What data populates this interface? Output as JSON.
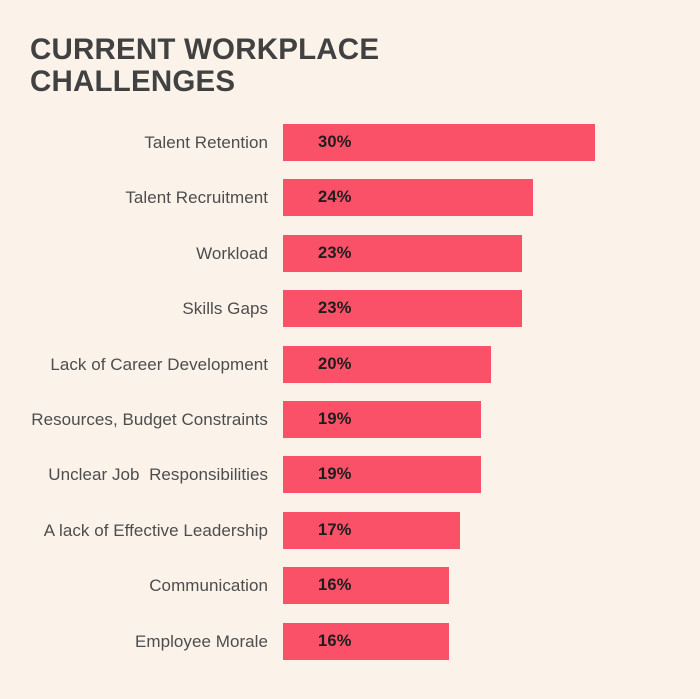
{
  "title": "Current Workplace\nChallenges",
  "colors": {
    "background": "#fbf2ea",
    "bar": "#fa5068",
    "title_text": "#414141",
    "label_text": "#4d4d4d",
    "value_text": "#1d1d1d"
  },
  "chart_data": {
    "type": "bar",
    "orientation": "horizontal",
    "title": "CURRENT WORKPLACE CHALLENGES",
    "xlabel": "",
    "ylabel": "",
    "grid": false,
    "legend": false,
    "axis_visible": false,
    "value_suffix": "%",
    "xlim": [
      0,
      30
    ],
    "categories": [
      "Talent Retention",
      "Talent Recruitment",
      "Workload",
      "Skills Gaps",
      "Lack of Career Development",
      "Resources, Budget Constraints",
      "Unclear Job  Responsibilities",
      "A lack of Effective Leadership",
      "Communication",
      "Employee Morale"
    ],
    "values": [
      30,
      24,
      23,
      23,
      20,
      19,
      19,
      17,
      16,
      16
    ],
    "value_labels": [
      "30%",
      "24%",
      "23%",
      "23%",
      "20%",
      "19%",
      "19%",
      "17%",
      "16%",
      "16%"
    ],
    "bars": [
      {
        "label": "Talent Retention",
        "value": 30,
        "value_label": "30%"
      },
      {
        "label": "Talent Recruitment",
        "value": 24,
        "value_label": "24%"
      },
      {
        "label": "Workload",
        "value": 23,
        "value_label": "23%"
      },
      {
        "label": "Skills Gaps",
        "value": 23,
        "value_label": "23%"
      },
      {
        "label": "Lack of Career Development",
        "value": 20,
        "value_label": "20%"
      },
      {
        "label": "Resources, Budget Constraints",
        "value": 19,
        "value_label": "19%"
      },
      {
        "label": "Unclear Job  Responsibilities",
        "value": 19,
        "value_label": "19%"
      },
      {
        "label": "A lack of Effective Leadership",
        "value": 17,
        "value_label": "17%"
      },
      {
        "label": "Communication",
        "value": 16,
        "value_label": "16%"
      },
      {
        "label": "Employee Morale",
        "value": 16,
        "value_label": "16%"
      }
    ]
  }
}
